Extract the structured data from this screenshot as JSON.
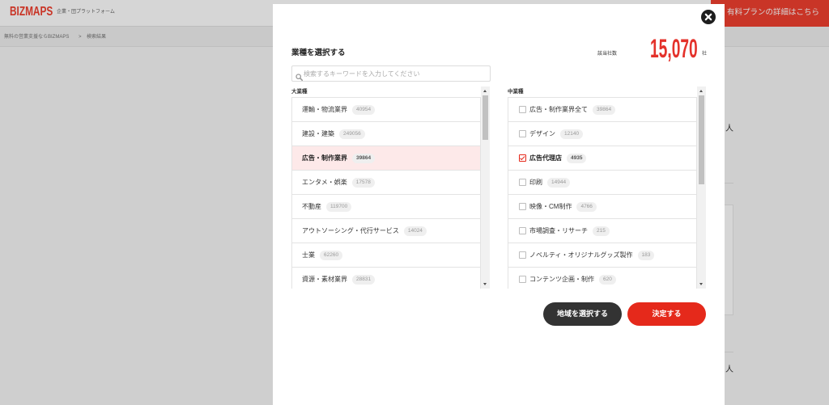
{
  "colors": {
    "brand": "#f0402f",
    "accent": "#e5291b",
    "count": "#e4322b",
    "dark_button": "#333333",
    "selected_bg": "#fde9e9"
  },
  "icons": {
    "close": "close-icon",
    "search": "search-icon",
    "check": "check-icon"
  },
  "header": {
    "logo": "BIZMAPS",
    "tagline": "企業・団プラットフォーム",
    "premium_link": "有料プランの詳細はこちら"
  },
  "breadcrumb": {
    "home": "無料の営業支援ならBIZMAPS",
    "separator": ">",
    "current": "検索結果"
  },
  "background": {
    "right_text_top": "人",
    "right_text_bottom": "人"
  },
  "modal": {
    "title": "業種を選択する",
    "count_label": "該当社数",
    "count_value": "15,070",
    "count_unit": "社",
    "search_placeholder": "検索するキーワードを入力してください",
    "major": {
      "header": "大業種",
      "items": [
        {
          "label": "運輸・物流業界",
          "count": "40954",
          "selected": false
        },
        {
          "label": "建設・建築",
          "count": "249056",
          "selected": false
        },
        {
          "label": "広告・制作業界",
          "count": "39864",
          "selected": true
        },
        {
          "label": "エンタメ・娯楽",
          "count": "17578",
          "selected": false
        },
        {
          "label": "不動産",
          "count": "119700",
          "selected": false
        },
        {
          "label": "アウトソーシング・代行サービス",
          "count": "14024",
          "selected": false
        },
        {
          "label": "士業",
          "count": "62260",
          "selected": false
        },
        {
          "label": "資源・素材業界",
          "count": "28831",
          "selected": false
        }
      ]
    },
    "minor": {
      "header": "中業種",
      "items": [
        {
          "label": "広告・制作業界全て",
          "count": "39864",
          "checked": false
        },
        {
          "label": "デザイン",
          "count": "12140",
          "checked": false
        },
        {
          "label": "広告代理店",
          "count": "4935",
          "checked": true
        },
        {
          "label": "印刷",
          "count": "14944",
          "checked": false
        },
        {
          "label": "映像・CM制作",
          "count": "4766",
          "checked": false
        },
        {
          "label": "市場調査・リサーチ",
          "count": "215",
          "checked": false
        },
        {
          "label": "ノベルティ・オリジナルグッズ製作",
          "count": "183",
          "checked": false
        },
        {
          "label": "コンテンツ企画・制作",
          "count": "620",
          "checked": false
        }
      ]
    },
    "region_button": "地域を選択する",
    "submit_button": "決定する"
  }
}
